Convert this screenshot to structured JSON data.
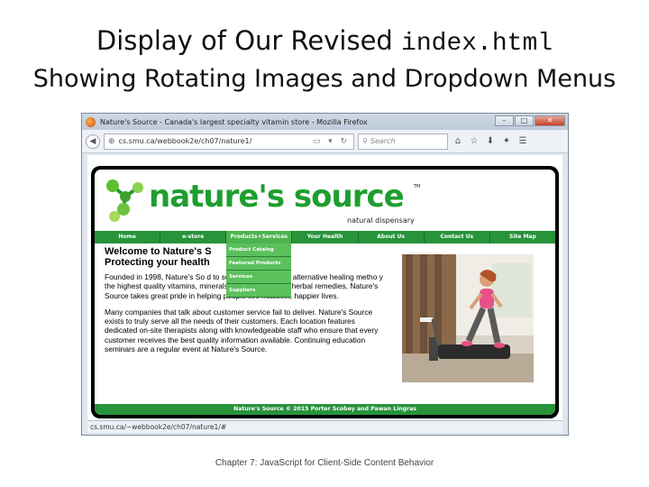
{
  "slide": {
    "title_line1": "Display of Our Revised",
    "title_code": "index.html",
    "title_line2": "Showing Rotating Images and Dropdown Menus",
    "caption": "Chapter 7: JavaScript for Client-Side Content Behavior"
  },
  "browser": {
    "window_title": "Nature's Source - Canada's largest specialty vitamin store - Mozilla Firefox",
    "url": "cs.smu.ca/webbook2e/ch07/nature1/",
    "search_placeholder": "Search",
    "status_url": "cs.smu.ca/~webbook2e/ch07/nature1/#",
    "icons": [
      "back-icon",
      "globe-icon",
      "reader-icon",
      "reload-icon",
      "home-icon",
      "bookmarks-icon",
      "download-icon",
      "menu-icon"
    ]
  },
  "site": {
    "logo_text": "nature's source",
    "logo_tm": "TM",
    "logo_sub": "natural dispensary",
    "menu": [
      {
        "label": "Home"
      },
      {
        "label": "e-store"
      },
      {
        "label": "Products+Services"
      },
      {
        "label": "Your Health"
      },
      {
        "label": "About Us"
      },
      {
        "label": "Contact Us"
      },
      {
        "label": "Site Map"
      }
    ],
    "dropdown": [
      {
        "label": "Product Catalog"
      },
      {
        "label": "Featured Products"
      },
      {
        "label": "Services"
      },
      {
        "label": "Suppliers"
      }
    ],
    "heading_line1": "Welcome to Nature's S",
    "heading_line2": "Protecting your health",
    "para1": "Founded in 1998, Nature's So                      d to serve those who use alternative healing metho                      y the highest quality vitamins, minerals, supplements and herbal remedies, Nature's Source takes great pride in helping people live healthier, happier lives.",
    "para2": "Many companies that talk about customer service fail to deliver. Nature's Source exists to truly serve all the needs of their customers. Each location features dedicated on-site therapists along with knowledgeable staff who ensure that every customer receives the best quality information available. Continuing education seminars are a regular event at Nature's Source.",
    "footer": "Nature's Source © 2015 Porter Scobey and Pawan Lingras"
  },
  "colors": {
    "brand_green": "#1e9e2e",
    "menu_green": "#27933a",
    "dropdown_green": "#5cc05d"
  }
}
